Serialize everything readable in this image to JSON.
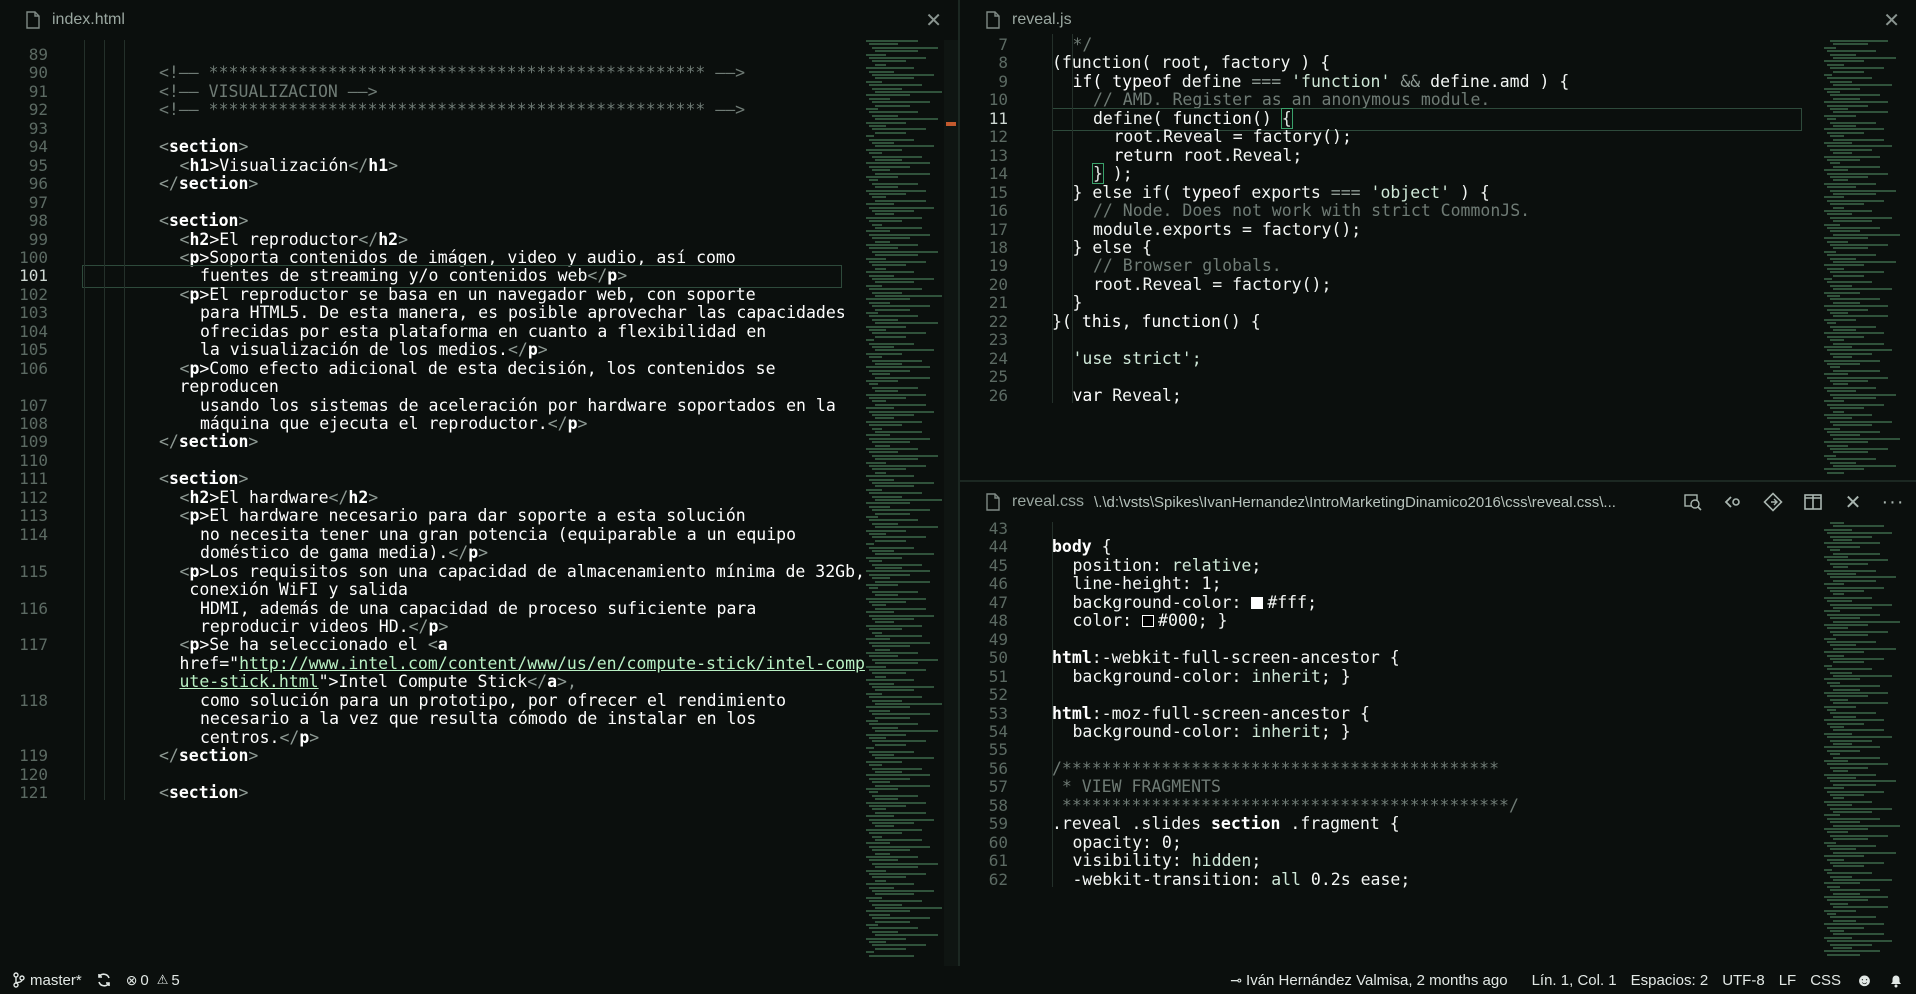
{
  "left_editor": {
    "tab": {
      "name": "index.html",
      "icon": "html-file-icon"
    },
    "first_line": 89,
    "active_line": 101,
    "lines": [
      {
        "n": "89",
        "t": ""
      },
      {
        "n": "90",
        "t": "<!—— ************************************************** ——>",
        "cls": "cm",
        "i": 2
      },
      {
        "n": "91",
        "t": "<!—— VISUALIZACION ——>",
        "cls": "cm",
        "i": 2
      },
      {
        "n": "92",
        "t": "<!—— ************************************************** ——>",
        "cls": "cm",
        "i": 2
      },
      {
        "n": "93",
        "t": ""
      },
      {
        "n": "94",
        "i": 2,
        "parts": [
          [
            "<",
            "pn"
          ],
          [
            "section",
            "tg"
          ],
          [
            ">",
            "pn"
          ]
        ]
      },
      {
        "n": "95",
        "i": 3,
        "parts": [
          [
            "<",
            "pn"
          ],
          [
            "h1",
            "tg"
          ],
          [
            ">Visualización",
            "kw"
          ],
          [
            "</",
            "pn"
          ],
          [
            "h1",
            "tg"
          ],
          [
            ">",
            "pn"
          ]
        ]
      },
      {
        "n": "96",
        "i": 2,
        "parts": [
          [
            "</",
            "pn"
          ],
          [
            "section",
            "tg"
          ],
          [
            ">",
            "pn"
          ]
        ]
      },
      {
        "n": "97",
        "t": ""
      },
      {
        "n": "98",
        "i": 2,
        "parts": [
          [
            "<",
            "pn"
          ],
          [
            "section",
            "tg"
          ],
          [
            ">",
            "pn"
          ]
        ]
      },
      {
        "n": "99",
        "i": 3,
        "parts": [
          [
            "<",
            "pn"
          ],
          [
            "h2",
            "tg"
          ],
          [
            ">El reproductor",
            "kw"
          ],
          [
            "</",
            "pn"
          ],
          [
            "h2",
            "tg"
          ],
          [
            ">",
            "pn"
          ]
        ]
      },
      {
        "n": "100",
        "i": 3,
        "parts": [
          [
            "<",
            "pn"
          ],
          [
            "p",
            "tg"
          ],
          [
            ">Soporta contenidos de imágen, video y audio, así como",
            "kw"
          ]
        ]
      },
      {
        "n": "101",
        "i": 4,
        "parts": [
          [
            "fuentes de streaming y/o contenidos web",
            "kw"
          ],
          [
            "</",
            "pn"
          ],
          [
            "p",
            "tg"
          ],
          [
            ">",
            "pn"
          ]
        ]
      },
      {
        "n": "102",
        "i": 3,
        "parts": [
          [
            "<",
            "pn"
          ],
          [
            "p",
            "tg"
          ],
          [
            ">El reproductor se basa en un navegador web, con soporte",
            "kw"
          ]
        ]
      },
      {
        "n": "103",
        "i": 4,
        "parts": [
          [
            "para HTML5. De esta manera, es posible aprovechar las capacidades",
            "kw"
          ]
        ]
      },
      {
        "n": "104",
        "i": 4,
        "parts": [
          [
            "ofrecidas por esta plataforma en cuanto a flexibilidad en",
            "kw"
          ]
        ]
      },
      {
        "n": "105",
        "i": 4,
        "parts": [
          [
            "la visualización de los medios.",
            "kw"
          ],
          [
            "</",
            "pn"
          ],
          [
            "p",
            "tg"
          ],
          [
            ">",
            "pn"
          ]
        ]
      },
      {
        "n": "106",
        "i": 3,
        "parts": [
          [
            "<",
            "pn"
          ],
          [
            "p",
            "tg"
          ],
          [
            ">Como efecto adicional de esta decisión, los contenidos se",
            "kw"
          ]
        ]
      },
      {
        "n": "",
        "i": 3,
        "parts": [
          [
            "reproducen",
            "kw"
          ]
        ]
      },
      {
        "n": "107",
        "i": 4,
        "parts": [
          [
            "usando los sistemas de aceleración por hardware soportados en la",
            "kw"
          ]
        ]
      },
      {
        "n": "108",
        "i": 4,
        "parts": [
          [
            "máquina que ejecuta el reproductor.",
            "kw"
          ],
          [
            "</",
            "pn"
          ],
          [
            "p",
            "tg"
          ],
          [
            ">",
            "pn"
          ]
        ]
      },
      {
        "n": "109",
        "i": 2,
        "parts": [
          [
            "</",
            "pn"
          ],
          [
            "section",
            "tg"
          ],
          [
            ">",
            "pn"
          ]
        ]
      },
      {
        "n": "110",
        "t": ""
      },
      {
        "n": "111",
        "i": 2,
        "parts": [
          [
            "<",
            "pn"
          ],
          [
            "section",
            "tg"
          ],
          [
            ">",
            "pn"
          ]
        ]
      },
      {
        "n": "112",
        "i": 3,
        "parts": [
          [
            "<",
            "pn"
          ],
          [
            "h2",
            "tg"
          ],
          [
            ">El hardware",
            "kw"
          ],
          [
            "</",
            "pn"
          ],
          [
            "h2",
            "tg"
          ],
          [
            ">",
            "pn"
          ]
        ]
      },
      {
        "n": "113",
        "i": 3,
        "parts": [
          [
            "<",
            "pn"
          ],
          [
            "p",
            "tg"
          ],
          [
            ">El hardware necesario para dar soporte a esta solución",
            "kw"
          ]
        ]
      },
      {
        "n": "114",
        "i": 4,
        "parts": [
          [
            "no necesita tener una gran potencia (equiparable a un equipo",
            "kw"
          ]
        ]
      },
      {
        "n": "",
        "i": 4,
        "parts": [
          [
            "doméstico de gama media).",
            "kw"
          ],
          [
            "</",
            "pn"
          ],
          [
            "p",
            "tg"
          ],
          [
            ">",
            "pn"
          ]
        ]
      },
      {
        "n": "115",
        "i": 3,
        "parts": [
          [
            "<",
            "pn"
          ],
          [
            "p",
            "tg"
          ],
          [
            ">Los requisitos son una capacidad de almacenamiento mínima de 32Gb,",
            "kw"
          ]
        ]
      },
      {
        "n": "",
        "i": 3,
        "parts": [
          [
            " conexión WiFI y salida",
            "kw"
          ]
        ]
      },
      {
        "n": "116",
        "i": 4,
        "parts": [
          [
            "HDMI, además de una capacidad de proceso suficiente para",
            "kw"
          ]
        ]
      },
      {
        "n": "",
        "i": 4,
        "parts": [
          [
            "reproducir videos HD.",
            "kw"
          ],
          [
            "</",
            "pn"
          ],
          [
            "p",
            "tg"
          ],
          [
            ">",
            "pn"
          ]
        ]
      },
      {
        "n": "117",
        "i": 3,
        "parts": [
          [
            "<",
            "pn"
          ],
          [
            "p",
            "tg"
          ],
          [
            ">Se ha seleccionado el ",
            "kw"
          ],
          [
            "<",
            "pn"
          ],
          [
            "a",
            "tg"
          ]
        ]
      },
      {
        "n": "",
        "i": 3,
        "parts": [
          [
            "href=\"",
            "kw"
          ],
          [
            "http://www.intel.com/content/www/us/en/compute-stick/intel-comp",
            "lnk"
          ]
        ]
      },
      {
        "n": "",
        "i": 3,
        "parts": [
          [
            "ute-stick.html",
            "lnk"
          ],
          [
            "\">Intel Compute Stick",
            "kw"
          ],
          [
            "</",
            "pn"
          ],
          [
            "a",
            "tg"
          ],
          [
            ">,",
            "pn"
          ]
        ]
      },
      {
        "n": "118",
        "i": 4,
        "parts": [
          [
            "como solución para un prototipo, por ofrecer el rendimiento",
            "kw"
          ]
        ]
      },
      {
        "n": "",
        "i": 4,
        "parts": [
          [
            "necesario a la vez que resulta cómodo de instalar en los",
            "kw"
          ]
        ]
      },
      {
        "n": "",
        "i": 4,
        "parts": [
          [
            "centros.",
            "kw"
          ],
          [
            "</",
            "pn"
          ],
          [
            "p",
            "tg"
          ],
          [
            ">",
            "pn"
          ]
        ]
      },
      {
        "n": "119",
        "i": 2,
        "parts": [
          [
            "</",
            "pn"
          ],
          [
            "section",
            "tg"
          ],
          [
            ">",
            "pn"
          ]
        ]
      },
      {
        "n": "120",
        "t": ""
      },
      {
        "n": "121",
        "i": 2,
        "parts": [
          [
            "<",
            "pn"
          ],
          [
            "section",
            "tg"
          ],
          [
            ">",
            "pn"
          ]
        ]
      }
    ]
  },
  "right_top_editor": {
    "tab": {
      "name": "reveal.js",
      "icon": "js-file-icon"
    },
    "lines": [
      {
        "n": "7",
        "i": 1,
        "parts": [
          [
            "*/",
            "cm"
          ]
        ]
      },
      {
        "n": "8",
        "i": 0,
        "parts": [
          [
            "(function( root, factory ) {",
            "fn"
          ]
        ]
      },
      {
        "n": "9",
        "i": 1,
        "parts": [
          [
            "if( ",
            "kw"
          ],
          [
            "typeof",
            "kw"
          ],
          [
            " define ",
            "fn"
          ],
          [
            "===",
            "pn"
          ],
          [
            " 'function' ",
            "str"
          ],
          [
            "&&",
            "pn"
          ],
          [
            " define.amd ) {",
            "fn"
          ]
        ]
      },
      {
        "n": "10",
        "i": 2,
        "parts": [
          [
            "// AMD. Register as an anonymous module.",
            "cm"
          ]
        ]
      },
      {
        "n": "11",
        "i": 2,
        "parts": [
          [
            "define( ",
            "fn"
          ],
          [
            "function",
            "kw"
          ],
          [
            "() ",
            "fn"
          ],
          [
            "{",
            "brk"
          ]
        ]
      },
      {
        "n": "12",
        "i": 3,
        "parts": [
          [
            "root.Reveal = factory();",
            "fn"
          ]
        ]
      },
      {
        "n": "13",
        "i": 3,
        "parts": [
          [
            "return",
            "kw"
          ],
          [
            " root.Reveal;",
            "fn"
          ]
        ]
      },
      {
        "n": "14",
        "i": 2,
        "parts": [
          [
            "}",
            "brk"
          ],
          [
            " );",
            "fn"
          ]
        ]
      },
      {
        "n": "15",
        "i": 1,
        "parts": [
          [
            "} else if( ",
            "fn"
          ],
          [
            "typeof",
            "kw"
          ],
          [
            " exports ",
            "fn"
          ],
          [
            "===",
            "pn"
          ],
          [
            " 'object' ",
            "str"
          ],
          [
            ") {",
            "fn"
          ]
        ]
      },
      {
        "n": "16",
        "i": 2,
        "parts": [
          [
            "// Node. Does not work with strict CommonJS.",
            "cm"
          ]
        ]
      },
      {
        "n": "17",
        "i": 2,
        "parts": [
          [
            "module.exports = factory();",
            "fn"
          ]
        ]
      },
      {
        "n": "18",
        "i": 1,
        "parts": [
          [
            "} else {",
            "fn"
          ]
        ]
      },
      {
        "n": "19",
        "i": 2,
        "parts": [
          [
            "// Browser globals.",
            "cm"
          ]
        ]
      },
      {
        "n": "20",
        "i": 2,
        "parts": [
          [
            "root.Reveal = factory();",
            "fn"
          ]
        ]
      },
      {
        "n": "21",
        "i": 1,
        "parts": [
          [
            "}",
            "fn"
          ]
        ]
      },
      {
        "n": "22",
        "i": 0,
        "parts": [
          [
            "}( ",
            "fn"
          ],
          [
            "this",
            "kw"
          ],
          [
            ", ",
            "fn"
          ],
          [
            "function",
            "kw"
          ],
          [
            "() {",
            "fn"
          ]
        ]
      },
      {
        "n": "23",
        "t": ""
      },
      {
        "n": "24",
        "i": 1,
        "parts": [
          [
            "'use strict';",
            "str"
          ]
        ]
      },
      {
        "n": "25",
        "t": ""
      },
      {
        "n": "26",
        "i": 1,
        "parts": [
          [
            "var",
            "kw"
          ],
          [
            " Reveal;",
            "fn"
          ]
        ]
      }
    ],
    "active_line": "11"
  },
  "right_bottom_editor": {
    "tab": {
      "name": "reveal.css",
      "path": "\\.\\d:\\vsts\\Spikes\\IvanHernandez\\IntroMarketingDinamico2016\\css\\reveal.css\\...",
      "icon": "css-file-icon"
    },
    "actions": [
      "open-changes-icon",
      "previous-change-icon",
      "next-change-icon",
      "split-editor-icon",
      "close-icon",
      "more-icon"
    ],
    "lines": [
      {
        "n": "43",
        "t": ""
      },
      {
        "n": "44",
        "i": 0,
        "parts": [
          [
            "body",
            "tg"
          ],
          [
            " {",
            "fn"
          ]
        ]
      },
      {
        "n": "45",
        "i": 1,
        "parts": [
          [
            "position: ",
            "fn"
          ],
          [
            "relative",
            "str"
          ],
          [
            ";",
            "fn"
          ]
        ]
      },
      {
        "n": "46",
        "i": 1,
        "parts": [
          [
            "line-height: 1;",
            "fn"
          ]
        ]
      },
      {
        "n": "47",
        "i": 1,
        "parts": [
          [
            "background-color: ",
            "fn"
          ],
          [
            "■",
            "sw1"
          ],
          [
            "#fff",
            "fn"
          ],
          [
            ";",
            "fn"
          ]
        ]
      },
      {
        "n": "48",
        "i": 1,
        "parts": [
          [
            "color: ",
            "fn"
          ],
          [
            "□",
            "sw2"
          ],
          [
            "#000",
            "fn"
          ],
          [
            "; }",
            "fn"
          ]
        ]
      },
      {
        "n": "49",
        "t": ""
      },
      {
        "n": "50",
        "i": 0,
        "parts": [
          [
            "html",
            "tg"
          ],
          [
            ":-webkit-full-screen-ancestor {",
            "fn"
          ]
        ]
      },
      {
        "n": "51",
        "i": 1,
        "parts": [
          [
            "background-color: ",
            "fn"
          ],
          [
            "inherit",
            "str"
          ],
          [
            "; }",
            "fn"
          ]
        ]
      },
      {
        "n": "52",
        "t": ""
      },
      {
        "n": "53",
        "i": 0,
        "parts": [
          [
            "html",
            "tg"
          ],
          [
            ":-moz-full-screen-ancestor {",
            "fn"
          ]
        ]
      },
      {
        "n": "54",
        "i": 1,
        "parts": [
          [
            "background-color: ",
            "fn"
          ],
          [
            "inherit",
            "str"
          ],
          [
            "; }",
            "fn"
          ]
        ]
      },
      {
        "n": "55",
        "t": ""
      },
      {
        "n": "56",
        "i": 0,
        "parts": [
          [
            "/********************************************",
            "cm"
          ]
        ]
      },
      {
        "n": "57",
        "i": 0,
        "parts": [
          [
            " * VIEW FRAGMENTS",
            "cm"
          ]
        ]
      },
      {
        "n": "58",
        "i": 0,
        "parts": [
          [
            " *********************************************/",
            "cm"
          ]
        ]
      },
      {
        "n": "59",
        "i": 0,
        "parts": [
          [
            ".reveal .slides ",
            "fn"
          ],
          [
            "section",
            "tg"
          ],
          [
            " .fragment {",
            "fn"
          ]
        ]
      },
      {
        "n": "60",
        "i": 1,
        "parts": [
          [
            "opacity: 0;",
            "fn"
          ]
        ]
      },
      {
        "n": "61",
        "i": 1,
        "parts": [
          [
            "visibility: ",
            "fn"
          ],
          [
            "hidden",
            "str"
          ],
          [
            ";",
            "fn"
          ]
        ]
      },
      {
        "n": "62",
        "i": 1,
        "parts": [
          [
            "-webkit-transition: ",
            "fn"
          ],
          [
            "all",
            "str"
          ],
          [
            " 0.2s ease;",
            "fn"
          ]
        ]
      }
    ]
  },
  "statusbar": {
    "branch": "master*",
    "errors": "0",
    "warnings": "5",
    "author": "Iván Hernández Valmisa, 2 months ago",
    "position": "Lín. 1, Col. 1",
    "indent": "Espacios: 2",
    "encoding": "UTF-8",
    "eol": "LF",
    "language": "CSS"
  },
  "colors": {
    "accent": "#3aa06a",
    "background": "#0b0f0d"
  }
}
